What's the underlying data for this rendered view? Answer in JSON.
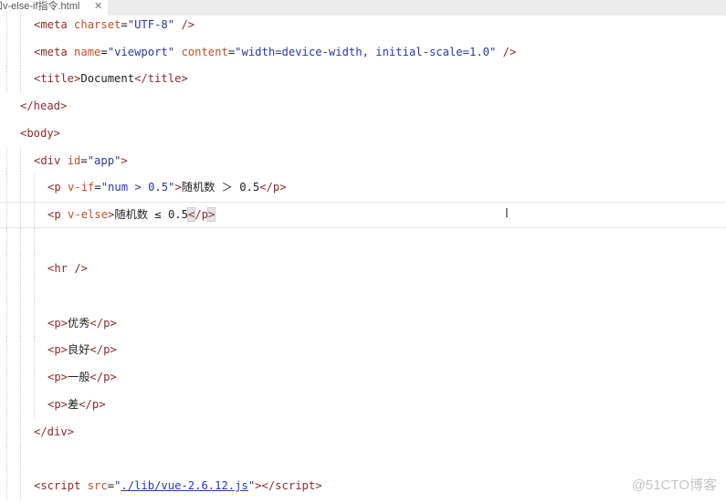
{
  "tab": {
    "title": "和v-else-if指令.html",
    "close": "✕"
  },
  "lines": [
    {
      "indent": 2,
      "tokens": [
        {
          "t": "<meta ",
          "c": "tag"
        },
        {
          "t": "charset",
          "c": "attr"
        },
        {
          "t": "=",
          "c": "txt"
        },
        {
          "t": "\"UTF-8\"",
          "c": "str"
        },
        {
          "t": " />",
          "c": "tag"
        }
      ]
    },
    {
      "indent": 2,
      "tokens": [
        {
          "t": "<meta ",
          "c": "tag"
        },
        {
          "t": "name",
          "c": "attr"
        },
        {
          "t": "=",
          "c": "txt"
        },
        {
          "t": "\"viewport\"",
          "c": "str"
        },
        {
          "t": " ",
          "c": "txt"
        },
        {
          "t": "content",
          "c": "attr"
        },
        {
          "t": "=",
          "c": "txt"
        },
        {
          "t": "\"width=device-width, initial-scale=1.0\"",
          "c": "str"
        },
        {
          "t": " />",
          "c": "tag"
        }
      ]
    },
    {
      "indent": 2,
      "tokens": [
        {
          "t": "<title>",
          "c": "tag"
        },
        {
          "t": "Document",
          "c": "txt"
        },
        {
          "t": "</title>",
          "c": "tag"
        }
      ]
    },
    {
      "indent": 1,
      "tokens": [
        {
          "t": "</head>",
          "c": "tag"
        }
      ]
    },
    {
      "indent": 1,
      "tokens": [
        {
          "t": "<body>",
          "c": "tag"
        }
      ]
    },
    {
      "indent": 2,
      "tokens": [
        {
          "t": "<div ",
          "c": "tag"
        },
        {
          "t": "id",
          "c": "attr"
        },
        {
          "t": "=",
          "c": "txt"
        },
        {
          "t": "\"app\"",
          "c": "str"
        },
        {
          "t": ">",
          "c": "tag"
        }
      ]
    },
    {
      "indent": 3,
      "tokens": [
        {
          "t": "<p ",
          "c": "tag"
        },
        {
          "t": "v-if",
          "c": "attr"
        },
        {
          "t": "=",
          "c": "txt"
        },
        {
          "t": "\"num > 0.5\"",
          "c": "str"
        },
        {
          "t": ">",
          "c": "tag"
        },
        {
          "t": "随机数 ＞ 0.5",
          "c": "txt"
        },
        {
          "t": "</p>",
          "c": "tag"
        }
      ]
    },
    {
      "indent": 3,
      "current": true,
      "tokens": [
        {
          "t": "<p ",
          "c": "tag"
        },
        {
          "t": "v-else",
          "c": "attr"
        },
        {
          "t": ">",
          "c": "tag"
        },
        {
          "t": "随机数 ≤ 0.5",
          "c": "txt"
        },
        {
          "t": "<",
          "c": "tag brk"
        },
        {
          "t": "/p",
          "c": "tag"
        },
        {
          "t": ">",
          "c": "tag brk"
        }
      ]
    },
    {
      "indent": 3,
      "tokens": []
    },
    {
      "indent": 3,
      "tokens": [
        {
          "t": "<hr />",
          "c": "tag"
        }
      ]
    },
    {
      "indent": 3,
      "tokens": []
    },
    {
      "indent": 3,
      "tokens": [
        {
          "t": "<p>",
          "c": "tag"
        },
        {
          "t": "优秀",
          "c": "txt"
        },
        {
          "t": "</p>",
          "c": "tag"
        }
      ]
    },
    {
      "indent": 3,
      "tokens": [
        {
          "t": "<p>",
          "c": "tag"
        },
        {
          "t": "良好",
          "c": "txt"
        },
        {
          "t": "</p>",
          "c": "tag"
        }
      ]
    },
    {
      "indent": 3,
      "tokens": [
        {
          "t": "<p>",
          "c": "tag"
        },
        {
          "t": "一般",
          "c": "txt"
        },
        {
          "t": "</p>",
          "c": "tag"
        }
      ]
    },
    {
      "indent": 3,
      "tokens": [
        {
          "t": "<p>",
          "c": "tag"
        },
        {
          "t": "差",
          "c": "txt"
        },
        {
          "t": "</p>",
          "c": "tag"
        }
      ]
    },
    {
      "indent": 2,
      "tokens": [
        {
          "t": "</div>",
          "c": "tag"
        }
      ]
    },
    {
      "indent": 2,
      "tokens": []
    },
    {
      "indent": 2,
      "tokens": [
        {
          "t": "<script ",
          "c": "tag"
        },
        {
          "t": "src",
          "c": "attr"
        },
        {
          "t": "=",
          "c": "txt"
        },
        {
          "t": "\"",
          "c": "str"
        },
        {
          "t": "./lib/vue-2.6.12.js",
          "c": "link"
        },
        {
          "t": "\"",
          "c": "str"
        },
        {
          "t": "></script>",
          "c": "tag"
        }
      ]
    }
  ],
  "watermark": "@51CTO博客"
}
